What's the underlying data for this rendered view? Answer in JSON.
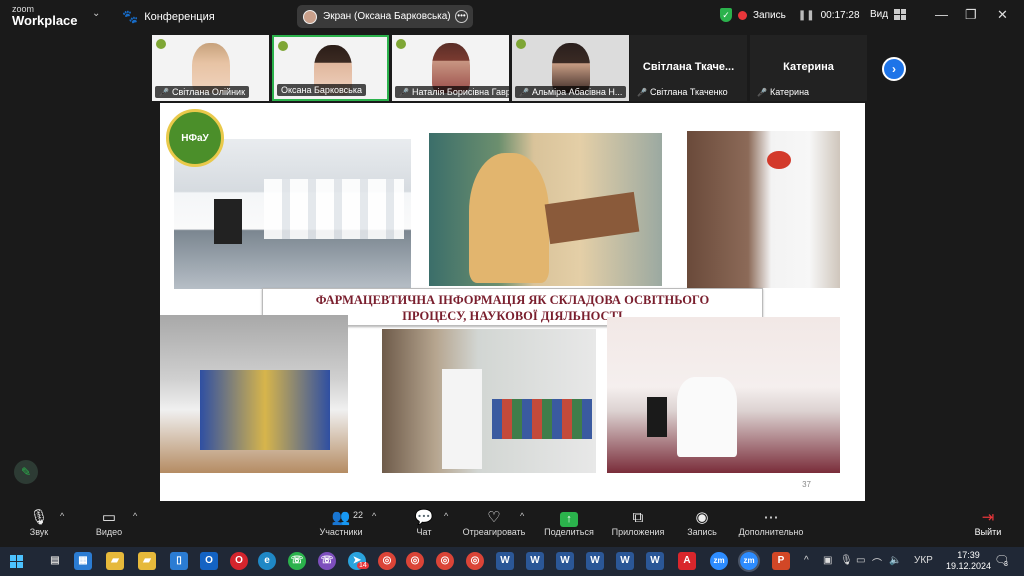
{
  "app": {
    "brand_line1": "zoom",
    "brand_line2": "Workplace",
    "meeting_name": "Конференция"
  },
  "share": {
    "label": "Экран (Оксана Барковська)"
  },
  "recording": {
    "label": "Запись",
    "timer": "00:17:28"
  },
  "view": {
    "label": "Вид"
  },
  "participants": [
    {
      "name": "Світлана Олійник",
      "muted": true
    },
    {
      "name": "Оксана Барковська",
      "muted": false,
      "active": true
    },
    {
      "name": "Наталія Борисівна Гавр...",
      "muted": true
    },
    {
      "name": "Альміра Абасівна Н...",
      "muted": true
    },
    {
      "name": "Світлана Ткаченко",
      "display": "Світлана Ткаче...",
      "muted": true
    },
    {
      "name": "Катерина",
      "display": "Катерина",
      "muted": true
    }
  ],
  "slide": {
    "logo_text": "НФаУ",
    "title_line1": "ФАРМАЦЕВТИЧНА ІНФОРМАЦІЯ ЯК СКЛАДОВА  ОСВІТНЬОГО",
    "title_line2": "ПРОЦЕСУ, НАУКОВОЇ ДІЯЛЬНОСТІ",
    "page_number": "37"
  },
  "toolbar": {
    "audio": "Звук",
    "video": "Видео",
    "participants": "Участники",
    "participants_count": "22",
    "chat": "Чат",
    "react": "Отреагировать",
    "share": "Поделиться",
    "apps": "Приложения",
    "record": "Запись",
    "more": "Дополнительно",
    "leave": "Выйти"
  },
  "taskbar": {
    "telegram_badge": "14",
    "language": "УКР",
    "time": "17:39",
    "date": "19.12.2024",
    "notifications": "3"
  },
  "colors": {
    "accent_green": "#2bb24c",
    "zoom_blue": "#1e74e8",
    "record_red": "#e8363a",
    "title_maroon": "#7a1f2e"
  }
}
